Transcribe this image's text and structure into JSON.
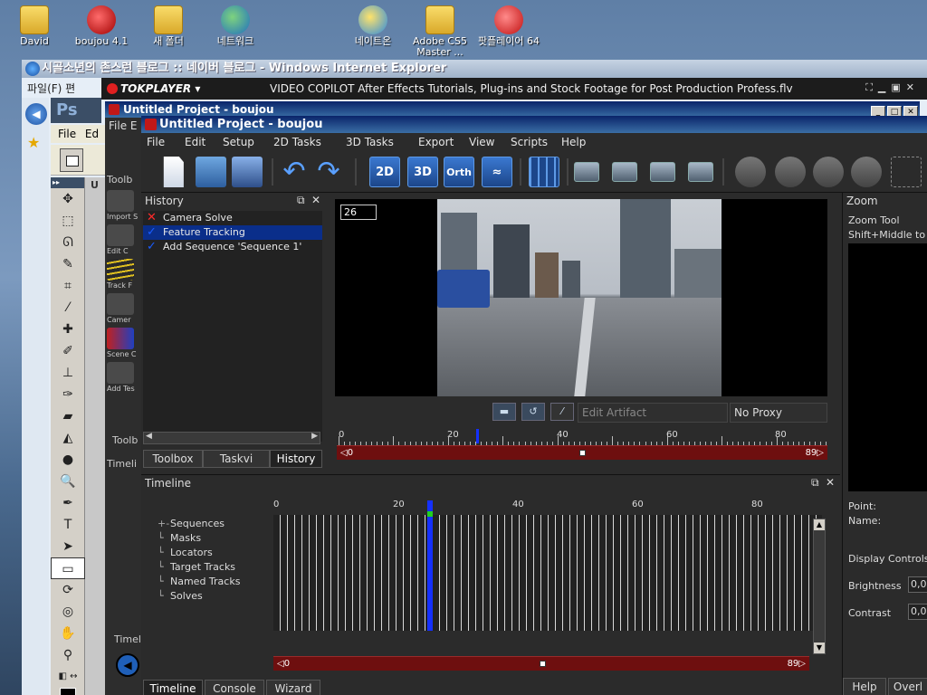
{
  "desktop": {
    "icons": [
      {
        "label": "David"
      },
      {
        "label": "boujou 4.1"
      },
      {
        "label": "새 폴더"
      },
      {
        "label": "네트워크"
      },
      {
        "label": "네이트온"
      },
      {
        "label": "Adobe CS5 Master ..."
      },
      {
        "label": "팟플레이어 64"
      }
    ]
  },
  "ie": {
    "title": "시골소년의 촌스런 블로그 :: 네이버 블로그 - Windows Internet Explorer",
    "menu": "파일(F)  편"
  },
  "photoshop": {
    "logo": "Ps",
    "menu_file": "File",
    "menu_edit": "Ed",
    "panel_letter": "U"
  },
  "tokplayer": {
    "logo": "TOKPLAYER",
    "title": "VIDEO COPILOT   After Effects Tutorials, Plug-ins and Stock Footage for Post Production Profess.flv"
  },
  "boujou_back": {
    "title": "Untitled Project - boujou",
    "menu_file": "File",
    "menu_e": "E",
    "tools": [
      "Import S",
      "Edit C",
      "Track F",
      "Camer",
      "Scene C",
      "Add Tes"
    ],
    "toolbox_label": "Toolb",
    "timeline_label": "Timeli",
    "timeline_label2": "Timel"
  },
  "boujou": {
    "title": "Untitled Project - boujou",
    "menu": [
      "File",
      "Edit",
      "Setup",
      "2D Tasks",
      "3D Tasks",
      "Export",
      "View",
      "Scripts",
      "Help"
    ],
    "toolbar": {
      "btn_2d": "2D",
      "btn_3d": "3D",
      "btn_orth": "Orth"
    },
    "history": {
      "title": "History",
      "items": [
        {
          "label": "Camera Solve",
          "mark": "✕",
          "mark_color": "#ff2a2a",
          "selected": false
        },
        {
          "label": "Feature Tracking",
          "mark": "✓",
          "mark_color": "#1a5cff",
          "selected": true
        },
        {
          "label": "Add Sequence  'Sequence  1'",
          "mark": "✓",
          "mark_color": "#1a5cff",
          "selected": false
        }
      ],
      "tabs": [
        "Toolbox",
        "Taskvi",
        "History"
      ],
      "active_tab": "History"
    },
    "viewer": {
      "frame": "26",
      "edit_artifact": "Edit Artifact",
      "proxy": "No Proxy",
      "ruler_labels": [
        "0",
        "20",
        "40",
        "60",
        "80"
      ],
      "scrub_start": "0",
      "scrub_end": "89"
    },
    "zoom": {
      "title": "Zoom",
      "tool": "Zoom Tool",
      "hint": "Shift+Middle to",
      "point": "Point:",
      "name": "Name:",
      "display_controls": "Display Controls",
      "brightness": "Brightness",
      "brightness_value": "0,0",
      "contrast": "Contrast",
      "contrast_value": "0,0",
      "help": "Help",
      "overlay": "Overl"
    },
    "timeline": {
      "title": "Timeline",
      "ruler_labels": [
        "0",
        "20",
        "40",
        "60",
        "80"
      ],
      "tree": [
        "Sequences",
        "Masks",
        "Locators",
        "Target Tracks",
        "Named Tracks",
        "Solves"
      ],
      "scrub_start": "0",
      "scrub_end": "89",
      "tabs": [
        "Timeline",
        "Console",
        "Wizard"
      ],
      "active_tab": "Timeline"
    }
  }
}
